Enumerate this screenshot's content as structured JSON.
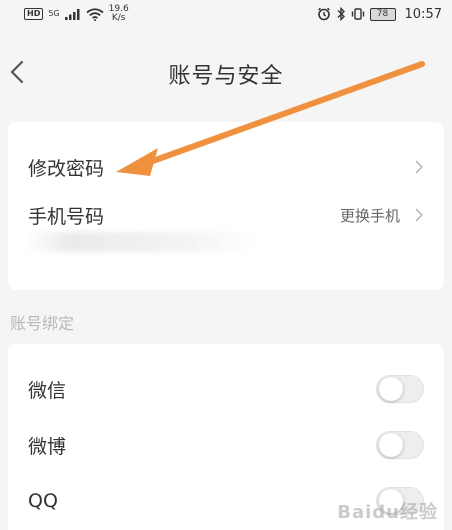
{
  "status_bar": {
    "hd": "HD",
    "network": "5G",
    "speed_value": "19.6",
    "speed_unit": "K/s",
    "battery": "78",
    "time": "10:57"
  },
  "header": {
    "title": "账号与安全"
  },
  "security": {
    "change_password": "修改密码",
    "phone_number": "手机号码",
    "change_phone": "更换手机"
  },
  "binding": {
    "section_title": "账号绑定",
    "items": [
      {
        "label": "微信",
        "enabled": false
      },
      {
        "label": "微博",
        "enabled": false
      },
      {
        "label": "QQ",
        "enabled": false
      }
    ]
  },
  "annotation": {
    "arrow_color": "#f0913f"
  },
  "watermark": {
    "text": "Baidu经验"
  }
}
